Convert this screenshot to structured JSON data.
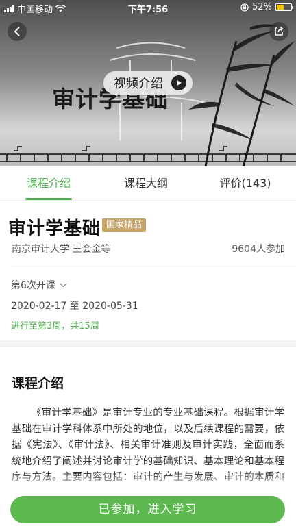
{
  "status_bar": {
    "carrier": "中国移动",
    "time": "下午7:56",
    "battery": "52%",
    "battery_level": 0.52
  },
  "hero": {
    "title": "审计学基础",
    "video_button_label": "视频介绍"
  },
  "tabs": [
    {
      "label": "课程介绍",
      "active": true
    },
    {
      "label": "课程大纲",
      "active": false
    },
    {
      "label": "评价(143)",
      "active": false
    }
  ],
  "course": {
    "title": "审计学基础",
    "badge": "国家精品",
    "school": "南京审计大学 王会金等",
    "participants": "9604人参加",
    "session": "第6次开课",
    "dates": "2020-02-17 至 2020-05-31",
    "progress": "进行至第3周，共15周"
  },
  "intro": {
    "heading": "课程介绍",
    "text": "《审计学基础》是审计专业的专业基础课程。根据审计学基础在审计学科体系中所处的地位，以及后续课程的需要，依据《宪法》、《审计法》、相关审计准则及审计实践，全面而系统地介绍了阐述并讨论审计学的基础知识、基本理论和基本程序与方法。主要内容包括：审计的产生与发展、审计的本质和职能、目标和过程、标准、证据和工作底稿、审计报告等。"
  },
  "bottom": {
    "join_label": "已参加，进入学习"
  },
  "colors": {
    "accent": "#4cae4c",
    "button": "#5cb84f",
    "badge": "#c8a66c"
  }
}
